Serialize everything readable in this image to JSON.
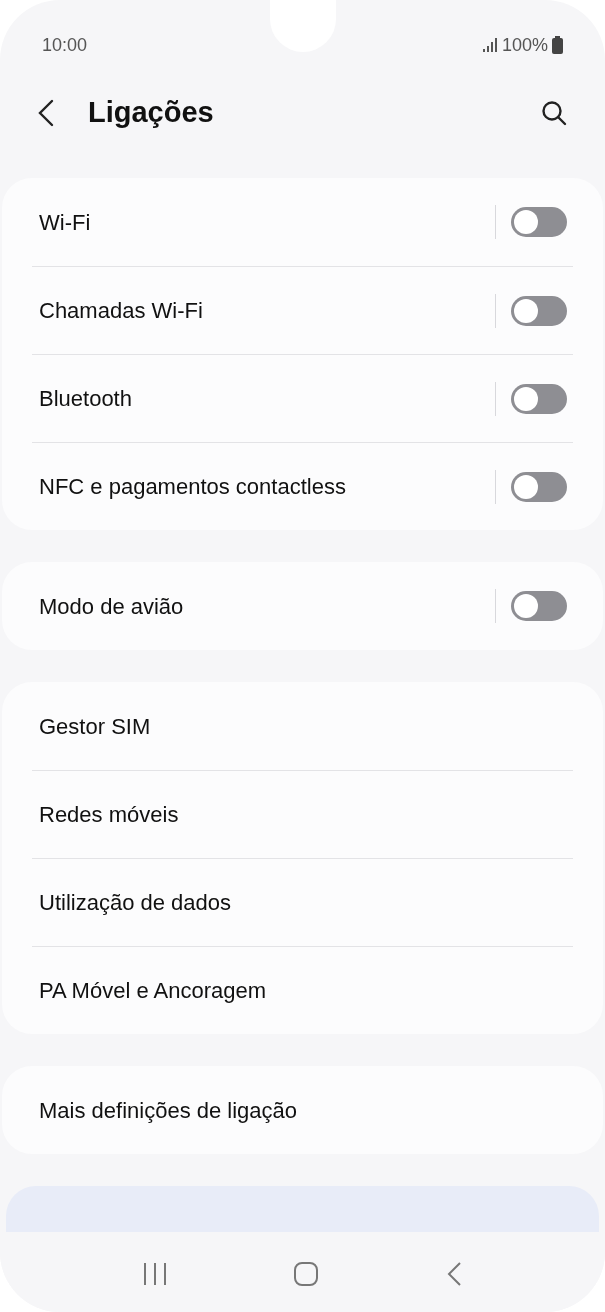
{
  "status_bar": {
    "time": "10:00",
    "battery": "100%"
  },
  "header": {
    "title": "Ligações"
  },
  "groups": [
    {
      "items": [
        {
          "label": "Wi-Fi",
          "kind": "toggle",
          "on": false
        },
        {
          "label": "Chamadas Wi-Fi",
          "kind": "toggle",
          "on": false
        },
        {
          "label": "Bluetooth",
          "kind": "toggle",
          "on": false
        },
        {
          "label": "NFC e pagamentos contactless",
          "kind": "toggle",
          "on": false
        }
      ]
    },
    {
      "items": [
        {
          "label": "Modo de avião",
          "kind": "toggle",
          "on": false
        }
      ]
    },
    {
      "items": [
        {
          "label": "Gestor SIM",
          "kind": "link"
        },
        {
          "label": "Redes móveis",
          "kind": "link"
        },
        {
          "label": "Utilização de dados",
          "kind": "link"
        },
        {
          "label": "PA Móvel e Ancoragem",
          "kind": "link"
        }
      ]
    },
    {
      "items": [
        {
          "label": "Mais definições de ligação",
          "kind": "link"
        }
      ]
    }
  ]
}
